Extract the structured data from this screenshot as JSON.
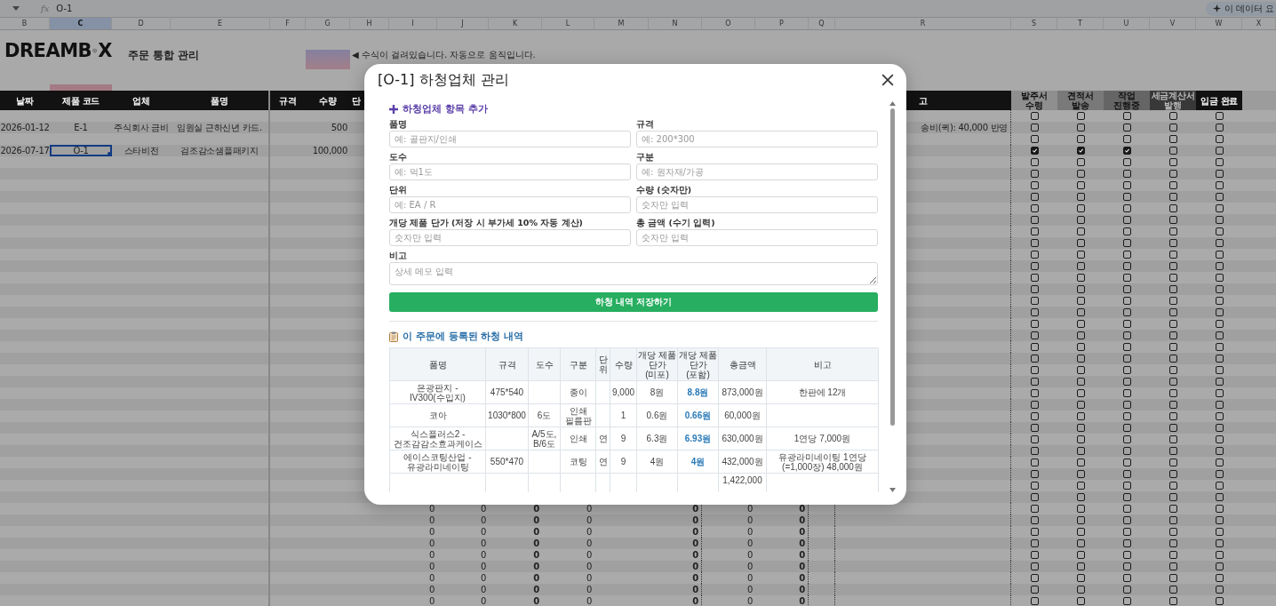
{
  "formula_bar": {
    "fx": "fx",
    "value": "O-1"
  },
  "summary_button": "이 데이터 요",
  "columns": [
    {
      "letter": "B",
      "selected": false
    },
    {
      "letter": "C",
      "selected": true
    },
    {
      "letter": "D",
      "selected": false
    },
    {
      "letter": "E",
      "selected": false
    },
    {
      "letter": "F",
      "selected": false
    },
    {
      "letter": "G",
      "selected": false
    },
    {
      "letter": "H",
      "selected": false
    },
    {
      "letter": "I",
      "selected": false
    },
    {
      "letter": "J",
      "selected": false
    },
    {
      "letter": "K",
      "selected": false
    },
    {
      "letter": "L",
      "selected": false
    },
    {
      "letter": "M",
      "selected": false
    },
    {
      "letter": "N",
      "selected": false
    },
    {
      "letter": "O",
      "selected": false
    },
    {
      "letter": "P",
      "selected": false
    },
    {
      "letter": "Q",
      "selected": false
    },
    {
      "letter": "R",
      "selected": false
    },
    {
      "letter": "S",
      "selected": false
    },
    {
      "letter": "T",
      "selected": false
    },
    {
      "letter": "U",
      "selected": false
    },
    {
      "letter": "V",
      "selected": false
    },
    {
      "letter": "W",
      "selected": false
    },
    {
      "letter": "X",
      "selected": false
    }
  ],
  "logo": {
    "left": "DREAMB",
    "right": "X"
  },
  "sheet_title": "주문 통합 관리",
  "notice": "◀ 수식이 걸려있습니다. 자동으로 움직입니다.",
  "headers": [
    "날짜",
    "제품 코드",
    "업체",
    "품명",
    "규격",
    "수량",
    "단"
  ],
  "note_header": "고",
  "status_headers": [
    {
      "label": "발주서 수령",
      "color": "#8f8f8f"
    },
    {
      "label": "견적서 발송",
      "color": "#797979"
    },
    {
      "label": "작업 진행중",
      "color": "#656565"
    },
    {
      "label": "세금계산서 발행",
      "color": "#383838"
    },
    {
      "label": "입금 완료",
      "color": "#111111"
    }
  ],
  "rows": [
    {
      "selected": false,
      "checks": [
        false,
        false,
        false,
        false,
        false
      ]
    },
    {
      "date": "2026-01-12",
      "code": "E-1",
      "vendor": "주식회사 금비",
      "item": "임원실 근하신년 카드.",
      "qty": "500",
      "note": "송비(퀵): 40,000 반영",
      "selected": false,
      "checks": [
        false,
        false,
        false,
        false,
        false
      ]
    },
    {
      "selected": false,
      "checks": [
        false,
        false,
        false,
        false,
        false
      ]
    },
    {
      "date": "2026-07-17",
      "code": "O-1",
      "vendor": "스타비전",
      "item": "검조감소샘플패키지",
      "qty": "100,000",
      "selected": true,
      "checks": [
        true,
        true,
        true,
        false,
        false
      ]
    },
    {
      "selected": false,
      "checks": [
        false,
        false,
        false,
        false,
        false
      ]
    },
    {
      "selected": false,
      "checks": [
        false,
        false,
        false,
        false,
        false
      ]
    },
    {
      "selected": false,
      "checks": [
        false,
        false,
        false,
        false,
        false
      ]
    },
    {
      "selected": false,
      "checks": [
        false,
        false,
        false,
        false,
        false
      ]
    },
    {
      "selected": false,
      "checks": [
        false,
        false,
        false,
        false,
        false
      ]
    },
    {
      "selected": false,
      "checks": [
        false,
        false,
        false,
        false,
        false
      ]
    },
    {
      "selected": false,
      "checks": [
        false,
        false,
        false,
        false,
        false
      ]
    },
    {
      "selected": false,
      "checks": [
        false,
        false,
        false,
        false,
        false
      ]
    },
    {
      "selected": false,
      "checks": [
        false,
        false,
        false,
        false,
        false
      ]
    },
    {
      "selected": false,
      "checks": [
        false,
        false,
        false,
        false,
        false
      ]
    },
    {
      "selected": false,
      "checks": [
        false,
        false,
        false,
        false,
        false
      ]
    },
    {
      "selected": false,
      "checks": [
        false,
        false,
        false,
        false,
        false
      ]
    },
    {
      "selected": false,
      "checks": [
        false,
        false,
        false,
        false,
        false
      ]
    },
    {
      "selected": false,
      "checks": [
        false,
        false,
        false,
        false,
        false
      ]
    },
    {
      "selected": false,
      "checks": [
        false,
        false,
        false,
        false,
        false
      ]
    },
    {
      "selected": false,
      "checks": [
        false,
        false,
        false,
        false,
        false
      ]
    },
    {
      "selected": false,
      "checks": [
        false,
        false,
        false,
        false,
        false
      ]
    },
    {
      "selected": false,
      "checks": [
        false,
        false,
        false,
        false,
        false
      ]
    },
    {
      "selected": false,
      "checks": [
        false,
        false,
        false,
        false,
        false
      ]
    },
    {
      "selected": false,
      "checks": [
        false,
        false,
        false,
        false,
        false
      ]
    },
    {
      "selected": false,
      "checks": [
        false,
        false,
        false,
        false,
        false
      ]
    },
    {
      "selected": false,
      "checks": [
        false,
        false,
        false,
        false,
        false
      ]
    },
    {
      "selected": false,
      "checks": [
        false,
        false,
        false,
        false,
        false
      ]
    },
    {
      "selected": false,
      "checks": [
        false,
        false,
        false,
        false,
        false
      ]
    },
    {
      "selected": false,
      "checks": [
        false,
        false,
        false,
        false,
        false
      ]
    },
    {
      "selected": false,
      "checks": [
        false,
        false,
        false,
        false,
        false
      ]
    },
    {
      "selected": false,
      "checks": [
        false,
        false,
        false,
        false,
        false
      ]
    },
    {
      "selected": false,
      "checks": [
        false,
        false,
        false,
        false,
        false
      ]
    },
    {
      "selected": false,
      "checks": [
        false,
        false,
        false,
        false,
        false
      ]
    },
    {
      "selected": false,
      "checks": [
        false,
        false,
        false,
        false,
        false
      ]
    },
    {
      "zeros": [
        "0",
        "0",
        "0",
        "0",
        "0",
        "0",
        "0"
      ],
      "selected": false,
      "checks": [
        false,
        false,
        false,
        false,
        false
      ]
    },
    {
      "zeros": [
        "0",
        "0",
        "0",
        "0",
        "0",
        "0",
        "0"
      ],
      "selected": false,
      "checks": [
        false,
        false,
        false,
        false,
        false
      ]
    },
    {
      "zeros": [
        "0",
        "0",
        "0",
        "0",
        "0",
        "0",
        "0"
      ],
      "selected": false,
      "checks": [
        false,
        false,
        false,
        false,
        false
      ]
    },
    {
      "zeros": [
        "0",
        "0",
        "0",
        "0",
        "0",
        "0",
        "0"
      ],
      "selected": false,
      "checks": [
        false,
        false,
        false,
        false,
        false
      ]
    },
    {
      "zeros": [
        "0",
        "0",
        "0",
        "0",
        "0",
        "0",
        "0"
      ],
      "selected": false,
      "checks": [
        false,
        false,
        false,
        false,
        false
      ]
    },
    {
      "zeros": [
        "0",
        "0",
        "0",
        "0",
        "0",
        "0",
        "0"
      ],
      "selected": false,
      "checks": [
        false,
        false,
        false,
        false,
        false
      ]
    },
    {
      "zeros": [
        "0",
        "0",
        "0",
        "0",
        "0",
        "0",
        "0"
      ],
      "selected": false,
      "checks": [
        false,
        false,
        false,
        false,
        false
      ]
    },
    {
      "zeros": [
        "0",
        "0",
        "0",
        "0",
        "0",
        "0",
        "0"
      ],
      "selected": false,
      "checks": [
        false,
        false,
        false,
        false,
        false
      ]
    },
    {
      "zeros": [
        "0",
        "0",
        "0",
        "0",
        "0",
        "0",
        "0"
      ],
      "selected": false,
      "checks": [
        false,
        false,
        false,
        false,
        false
      ]
    }
  ],
  "modal": {
    "title": "[O-1] 하청업체 관리",
    "add_section": "하청업체 항목 추가",
    "fields": [
      {
        "label": "품명",
        "placeholder": "예: 골판지/인쇄",
        "kind": "text"
      },
      {
        "label": "규격",
        "placeholder": "예: 200*300",
        "kind": "text"
      },
      {
        "label": "도수",
        "placeholder": "예: 먹1도",
        "kind": "text"
      },
      {
        "label": "구분",
        "placeholder": "예: 원자재/가공",
        "kind": "text"
      },
      {
        "label": "단위",
        "placeholder": "예: EA / R",
        "kind": "text"
      },
      {
        "label": "수량 (숫자만)",
        "placeholder": "숫자만 입력",
        "kind": "text"
      },
      {
        "label": "개당 제품 단가 (저장 시 부가세 10% 자동 계산)",
        "placeholder": "숫자만 입력",
        "kind": "text"
      },
      {
        "label": "총 금액 (수기 입력)",
        "placeholder": "숫자만 입력",
        "kind": "text"
      },
      {
        "label": "비고",
        "placeholder": "상세 메모 입력",
        "kind": "textarea"
      }
    ],
    "save_button": "하청 내역 저장하기",
    "list_title": "이 주문에 등록된 하청 내역",
    "table": {
      "columns": [
        "품명",
        "규격",
        "도수",
        "구분",
        "단위",
        "수량",
        "개당 제품 단가(미포)",
        "개당 제품 단가(포함)",
        "총금액",
        "비고"
      ],
      "rows": [
        {
          "name": "은광판지 - IV300(수입지)",
          "spec": "475*540",
          "type": "종이",
          "qty": "9,000",
          "net": "8원",
          "gross": "8.8원",
          "total": "873,000원",
          "note": "한판에 12개"
        },
        {
          "name": "코아",
          "spec": "1030*800",
          "colors": "6도",
          "type": "인쇄 필름판",
          "qty": "1",
          "net": "0.6원",
          "gross": "0.66원",
          "total": "60,000원"
        },
        {
          "name": "식스플러스2 - 건조감감소효과케이스",
          "colors": "A/5도, B/6도",
          "type": "인쇄",
          "unit": "연",
          "qty": "9",
          "net": "6.3원",
          "gross": "6.93원",
          "total": "630,000원",
          "note": "1연당 7,000원"
        },
        {
          "name": "에이스코팅산업 - 유광라미네이팅",
          "spec": "550*470",
          "type": "코팅",
          "unit": "연",
          "qty": "9",
          "net": "4원",
          "gross": "4원",
          "total": "432,000원",
          "note": "유광라미네이팅 1연당(=1,000장) 48,000원"
        },
        {
          "total": "1,422,000"
        }
      ]
    }
  }
}
